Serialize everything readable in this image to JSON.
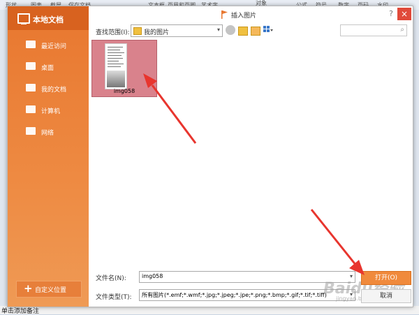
{
  "background_app": {
    "toolbar_labels": [
      "形状",
      "图表",
      "截屏",
      "保存文档",
      "文本框",
      "页眉和页脚",
      "艺术字",
      "对象",
      "公式",
      "符号",
      "数字",
      "页码",
      "水印"
    ],
    "bottom_text": "单击添加备注"
  },
  "dialog": {
    "title": "插入图片",
    "help_icon": "question-icon",
    "close_icon": "close-icon",
    "close_label": "×",
    "help_label": "?"
  },
  "sidebar": {
    "header": "本地文档",
    "items": [
      {
        "label": "最近访问",
        "icon": "recent-icon"
      },
      {
        "label": "桌面",
        "icon": "desktop-icon"
      },
      {
        "label": "我的文档",
        "icon": "folder-icon"
      },
      {
        "label": "计算机",
        "icon": "computer-icon"
      },
      {
        "label": "网络",
        "icon": "network-icon"
      }
    ],
    "add_button": "自定义位置"
  },
  "toolbar": {
    "lookin_label": "查找范围(I):",
    "lookin_value": "我的图片"
  },
  "files": [
    {
      "name": "img058",
      "selected": true
    }
  ],
  "bottom": {
    "filename_label": "文件名(N):",
    "filename_value": "img058",
    "filetype_label": "文件类型(T):",
    "filetype_value": "所有图片(*.emf;*.wmf;*.jpg;*.jpeg;*.jpe;*.png;*.bmp;*.gif;*.tif;*.tiff)",
    "open_button": "打开(O)",
    "cancel_button": "取消"
  },
  "watermark": {
    "text": "Baidu经验",
    "sub": "jingyan.baidu.com"
  },
  "colors": {
    "sidebar": "#e8772f",
    "selected_file": "#d9828c",
    "open_button": "#f08a3c",
    "arrow": "#e8352e"
  }
}
